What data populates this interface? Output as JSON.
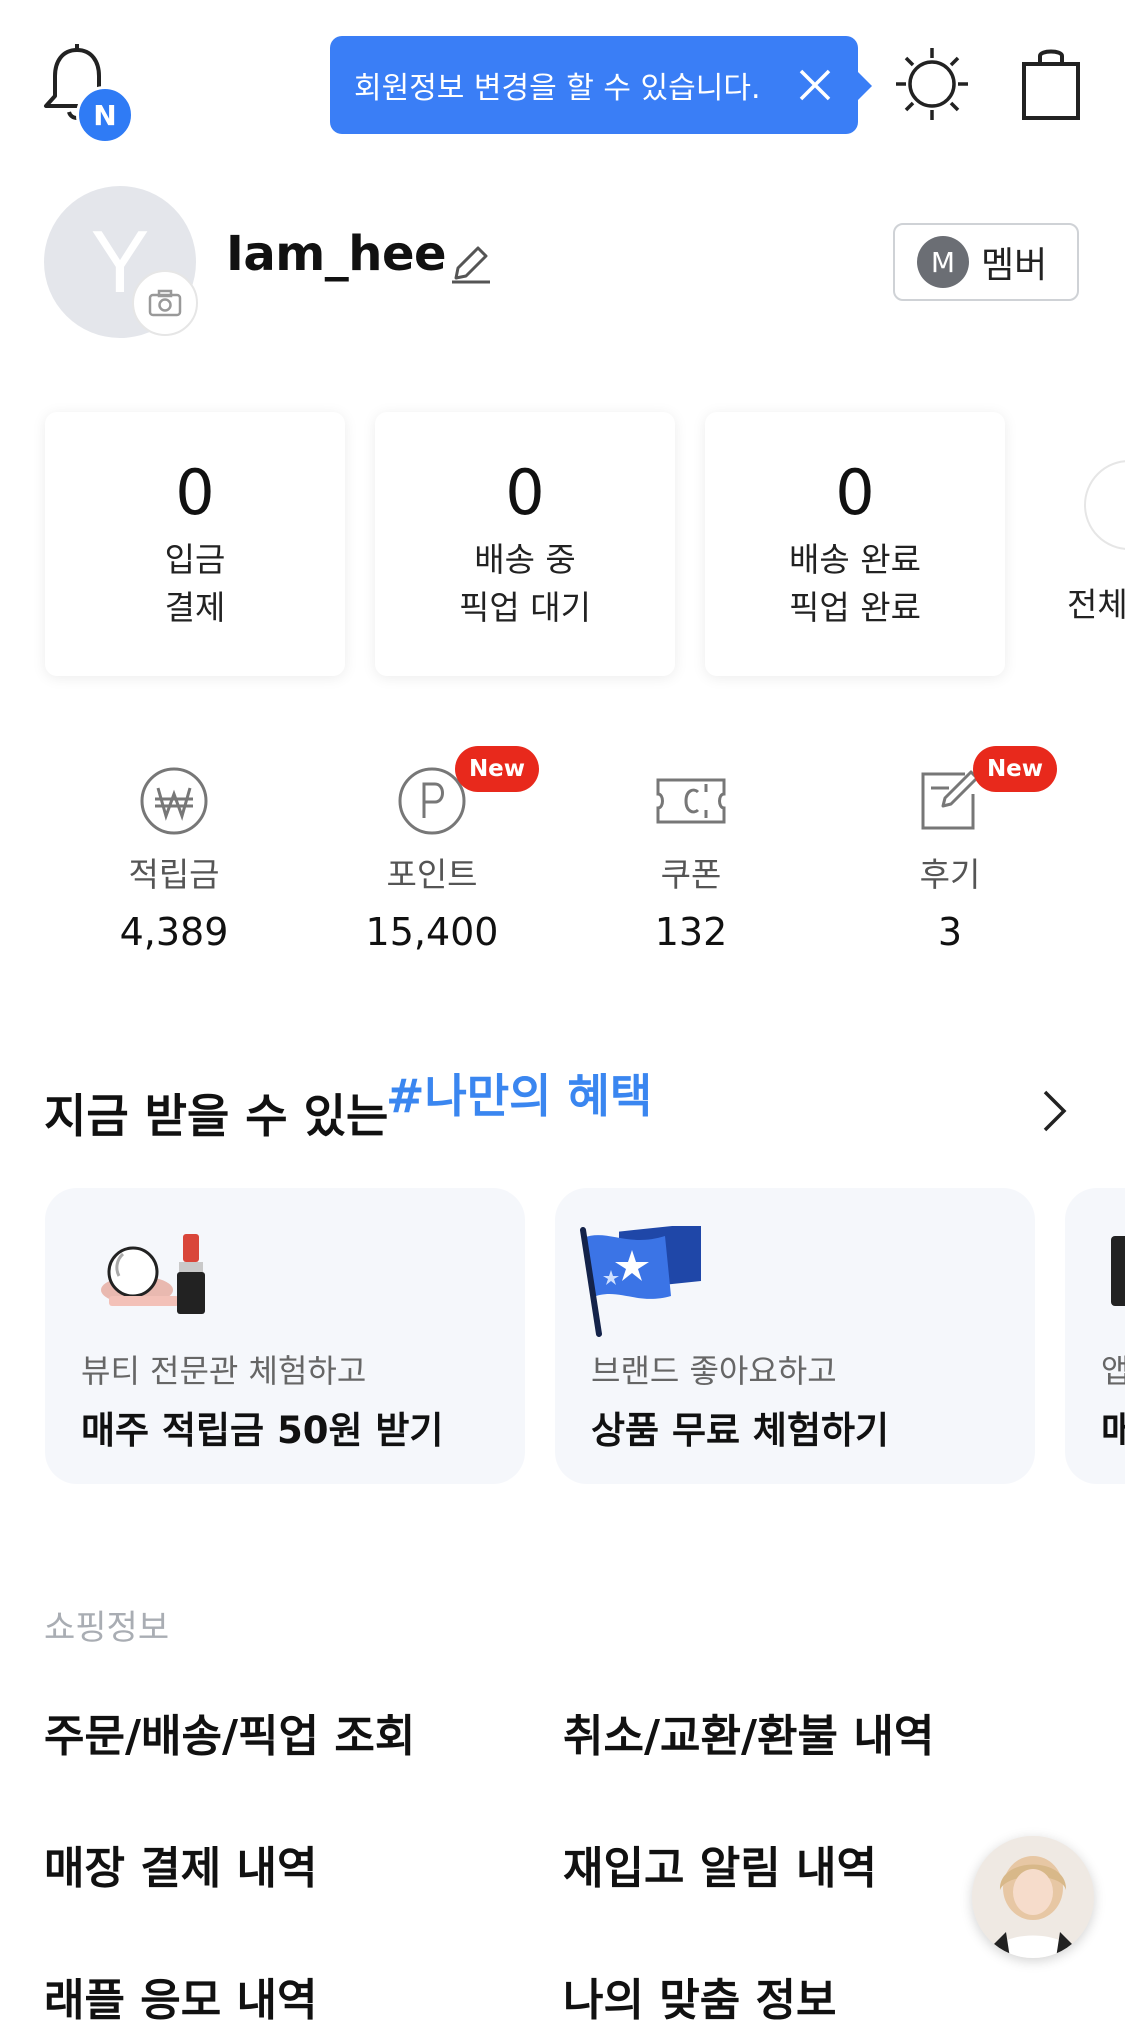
{
  "header": {
    "notification_badge": "N",
    "tooltip_text": "회원정보 변경을 할 수 있습니다."
  },
  "profile": {
    "avatar_letter": "Y",
    "username": "Iam_hee",
    "grade_initial": "M",
    "grade_label": "멤버"
  },
  "order_status": [
    {
      "count": "0",
      "line1": "입금",
      "line2": "결제"
    },
    {
      "count": "0",
      "line1": "배송 중",
      "line2": "픽업 대기"
    },
    {
      "count": "0",
      "line1": "배송 완료",
      "line2": "픽업 완료"
    }
  ],
  "order_view_all_label": "전체",
  "stats": [
    {
      "label": "적립금",
      "value": "4,389",
      "icon": "won-coin-icon"
    },
    {
      "label": "포인트",
      "value": "15,400",
      "icon": "point-icon",
      "badge": "New"
    },
    {
      "label": "쿠폰",
      "value": "132",
      "icon": "coupon-icon"
    },
    {
      "label": "후기",
      "value": "3",
      "icon": "review-icon",
      "badge": "New"
    }
  ],
  "benefits": {
    "title": "지금 받을 수 있는",
    "tag": "#나만의 혜택",
    "cards": [
      {
        "subtitle": "뷰티 전문관 체험하고",
        "title": "매주 적립금 50원 받기",
        "icon": "cosmetics-icon"
      },
      {
        "subtitle": "브랜드 좋아요하고",
        "title": "상품 무료 체험하기",
        "icon": "flag-icon"
      },
      {
        "subtitle": "앱",
        "title": "매",
        "icon": "partial-icon"
      }
    ]
  },
  "shopping_info": {
    "section_label": "쇼핑정보",
    "items": [
      "주문/배송/픽업 조회",
      "취소/교환/환불 내역",
      "매장 결제 내역",
      "재입고 알림 내역",
      "래플 응모 내역",
      "나의 맞춤 정보"
    ]
  },
  "colors": {
    "accent_blue": "#3a7ef6",
    "badge_red": "#e8291c",
    "card_bg": "#f5f7fb"
  }
}
